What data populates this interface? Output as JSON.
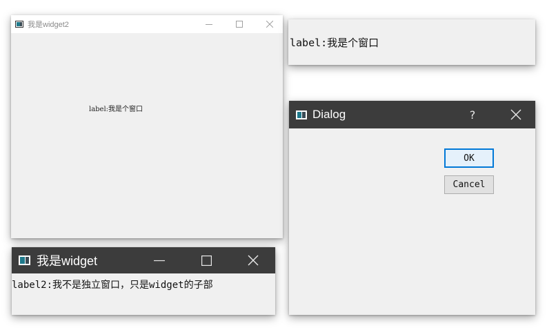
{
  "widget2": {
    "title": "我是widget2",
    "label": "label:我是个窗口",
    "controls": {
      "minimize": "minimize-icon",
      "maximize": "maximize-icon",
      "close": "close-icon"
    }
  },
  "frameless_window": {
    "label": "label:我是个窗口"
  },
  "dialog": {
    "title": "Dialog",
    "help_label": "?",
    "ok_label": "OK",
    "cancel_label": "Cancel",
    "controls": {
      "help": "help-icon",
      "close": "close-icon"
    }
  },
  "widget": {
    "title": "我是widget",
    "label": "label2:我不是独立窗口，只是widget的子部",
    "controls": {
      "minimize": "minimize-icon",
      "maximize": "maximize-icon",
      "close": "close-icon"
    }
  },
  "colors": {
    "dark_titlebar": "#3c3c3c",
    "light_titlebar": "#ffffff",
    "window_bg": "#f0f0f0",
    "focus_accent": "#0078d7"
  }
}
